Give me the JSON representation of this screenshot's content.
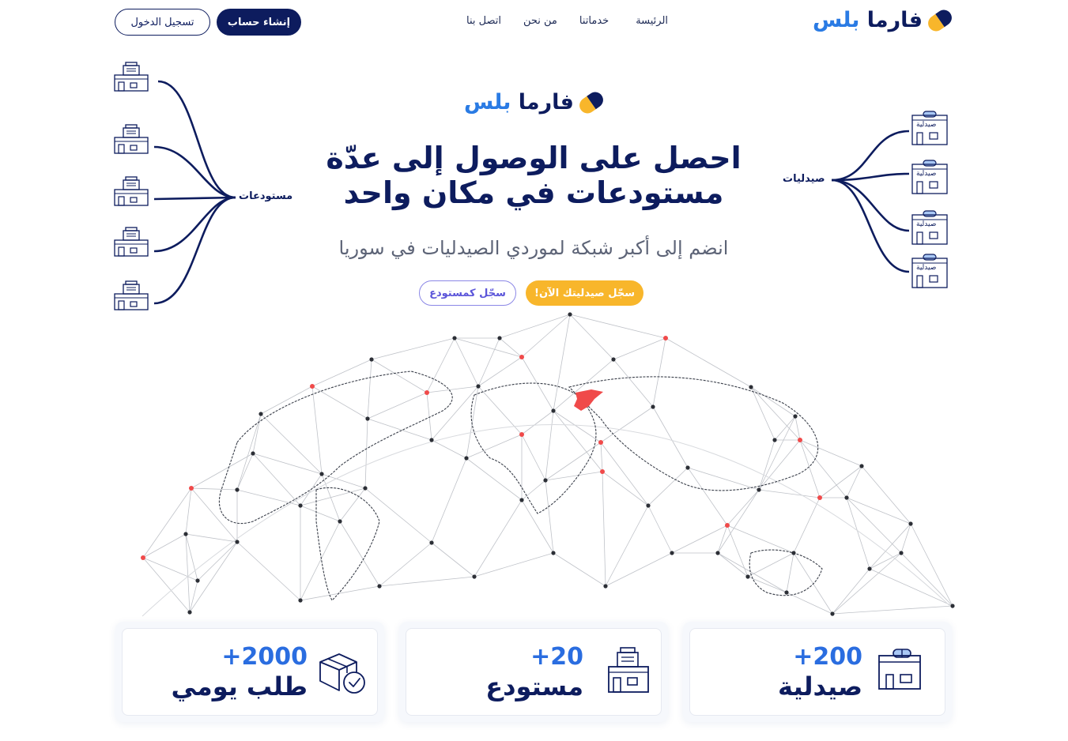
{
  "brand": {
    "word1": "فارما",
    "word2": "بلس"
  },
  "nav": {
    "items": [
      "الرئيسة",
      "خدماتنا",
      "من نحن",
      "اتصل بنا"
    ],
    "signup_label": "إنشاء حساب",
    "login_label": "تسجيل الدخول"
  },
  "hero": {
    "title_line1": "احصل على الوصول إلى عدّة",
    "title_line2": "مستودعات في مكان واحد",
    "subtitle": "انضم إلى أكبر شبكة لموردي الصيدليات في سوريا",
    "cta_primary": "سجّل صيدليتك الآن!",
    "cta_secondary": "سجّل كمستودع"
  },
  "diagram": {
    "left_label": "مستودعات",
    "right_label": "صيدليات",
    "pharmacy_sign": "صيدلية"
  },
  "stats": [
    {
      "number": "+200",
      "label": "صيدلية",
      "icon": "pharmacy-icon"
    },
    {
      "number": "+20",
      "label": "مستودع",
      "icon": "warehouse-icon"
    },
    {
      "number": "+2000",
      "label": "طلب يومي",
      "icon": "delivered-box-icon"
    }
  ],
  "colors": {
    "navy": "#0d1c5e",
    "accent_blue": "#2a7be4",
    "yellow": "#f8b62b",
    "highlight_red": "#f04a4a"
  }
}
